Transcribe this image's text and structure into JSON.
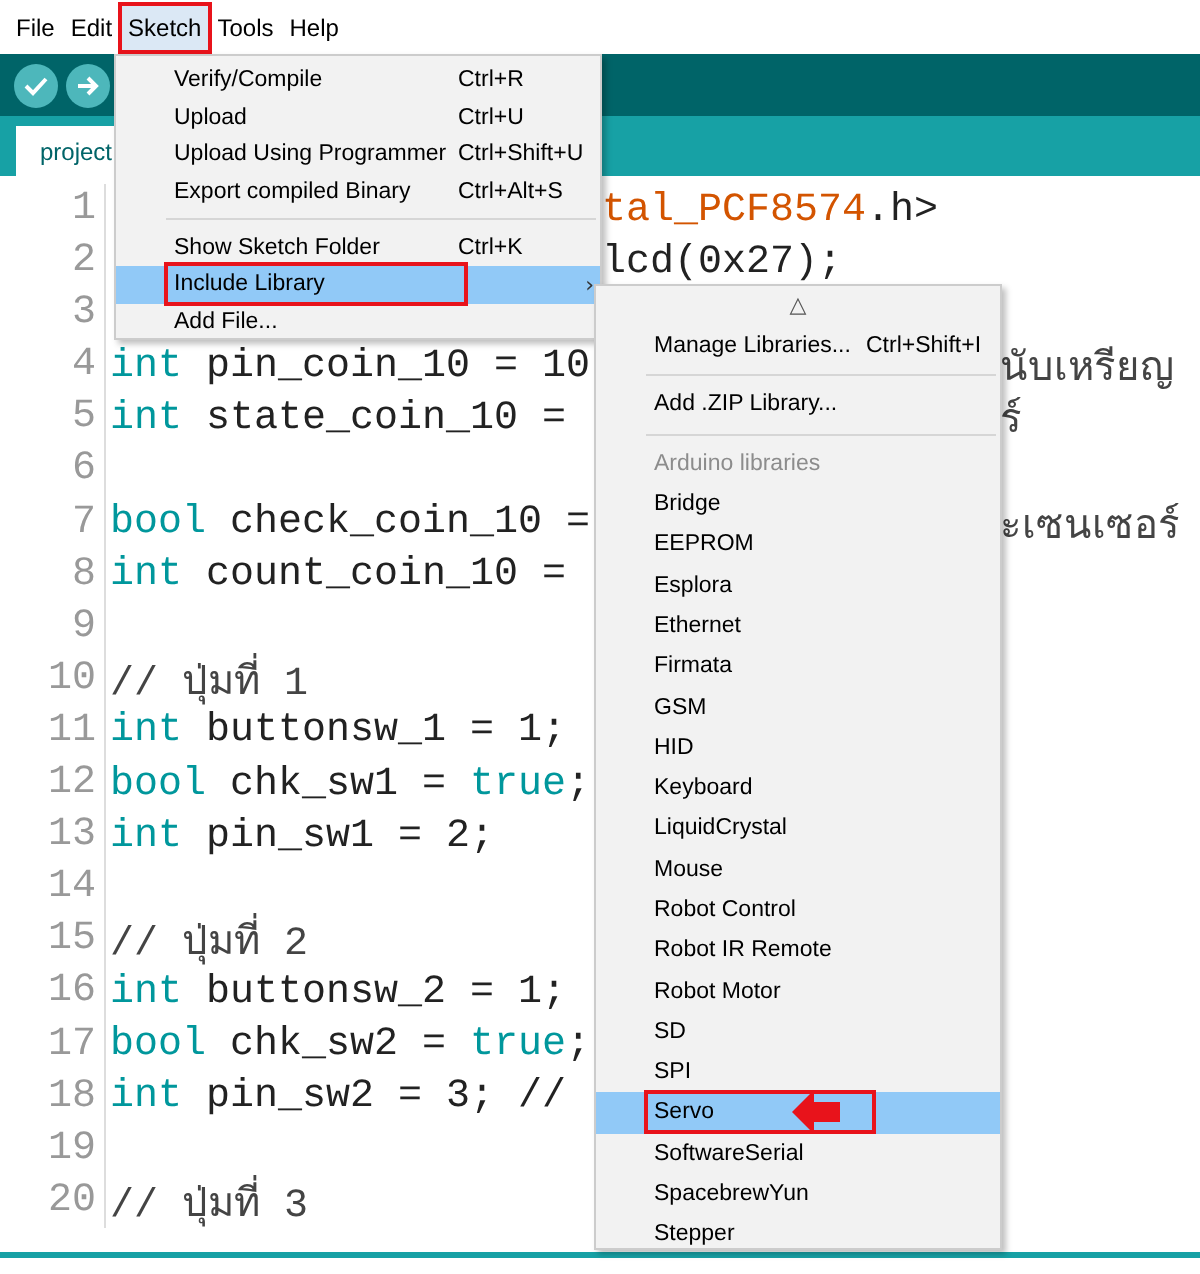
{
  "menu_bar": [
    {
      "label": "File",
      "selected": false
    },
    {
      "label": "Edit",
      "selected": false
    },
    {
      "label": "Sketch",
      "selected": true
    },
    {
      "label": "Tools",
      "selected": false
    },
    {
      "label": "Help",
      "selected": false
    }
  ],
  "tab": {
    "label": "project"
  },
  "editor_lines": [
    {
      "number": "1",
      "tail": {
        "kind": "beside-menu",
        "tokens": [
          {
            "text": "tal_PCF8574",
            "kind": "library"
          },
          {
            "text": ".h>",
            "kind": "plain"
          }
        ]
      }
    },
    {
      "number": "2",
      "tail": {
        "kind": "beside-menu",
        "tokens": [
          {
            "text": "lcd(0x27);",
            "kind": "plain"
          }
        ]
      }
    },
    {
      "number": "3"
    },
    {
      "number": "4",
      "code": [
        {
          "text": "int",
          "kind": "keyword"
        },
        {
          "text": " pin_coin_10 = 10",
          "kind": "plain"
        }
      ],
      "tail": {
        "kind": "beside-submenu",
        "tokens": [
          {
            "text": "นับเหรียญ",
            "kind": "comment"
          }
        ]
      }
    },
    {
      "number": "5",
      "code": [
        {
          "text": "int",
          "kind": "keyword"
        },
        {
          "text": " state_coin_10 =",
          "kind": "plain"
        }
      ],
      "tail": {
        "kind": "beside-submenu",
        "tokens": [
          {
            "text": "ร์",
            "kind": "comment"
          }
        ]
      }
    },
    {
      "number": "6"
    },
    {
      "number": "7",
      "code": [
        {
          "text": "bool",
          "kind": "keyword"
        },
        {
          "text": " check_coin_10 =",
          "kind": "plain"
        }
      ],
      "tail": {
        "kind": "beside-submenu",
        "tokens": [
          {
            "text": "ะเซนเซอร์",
            "kind": "comment"
          }
        ]
      }
    },
    {
      "number": "8",
      "code": [
        {
          "text": "int",
          "kind": "keyword"
        },
        {
          "text": " count_coin_10 =",
          "kind": "plain"
        }
      ]
    },
    {
      "number": "9"
    },
    {
      "number": "10",
      "code": [
        {
          "text": "// ปุ่มที่ 1",
          "kind": "comment"
        }
      ]
    },
    {
      "number": "11",
      "code": [
        {
          "text": "int",
          "kind": "keyword"
        },
        {
          "text": " buttonsw_1 = 1;",
          "kind": "plain"
        }
      ]
    },
    {
      "number": "12",
      "code": [
        {
          "text": "bool",
          "kind": "keyword"
        },
        {
          "text": " chk_sw1 = ",
          "kind": "plain"
        },
        {
          "text": "true",
          "kind": "keyword"
        },
        {
          "text": ";",
          "kind": "plain"
        }
      ]
    },
    {
      "number": "13",
      "code": [
        {
          "text": "int",
          "kind": "keyword"
        },
        {
          "text": " pin_sw1 = 2;",
          "kind": "plain"
        }
      ]
    },
    {
      "number": "14"
    },
    {
      "number": "15",
      "code": [
        {
          "text": "// ปุ่มที่ 2",
          "kind": "comment"
        }
      ]
    },
    {
      "number": "16",
      "code": [
        {
          "text": "int",
          "kind": "keyword"
        },
        {
          "text": " buttonsw_2 = 1;",
          "kind": "plain"
        }
      ]
    },
    {
      "number": "17",
      "code": [
        {
          "text": "bool",
          "kind": "keyword"
        },
        {
          "text": " chk_sw2 = ",
          "kind": "plain"
        },
        {
          "text": "true",
          "kind": "keyword"
        },
        {
          "text": ";",
          "kind": "plain"
        }
      ]
    },
    {
      "number": "18",
      "code": [
        {
          "text": "int",
          "kind": "keyword"
        },
        {
          "text": " pin_sw2 = 3; //",
          "kind": "plain"
        }
      ]
    },
    {
      "number": "19"
    },
    {
      "number": "20",
      "code": [
        {
          "text": "// ปุ่มที่ 3",
          "kind": "comment"
        }
      ]
    }
  ],
  "sketch_menu": [
    {
      "kind": "item",
      "label": "Verify/Compile",
      "shortcut": "Ctrl+R",
      "selected": false
    },
    {
      "kind": "item",
      "label": "Upload",
      "shortcut": "Ctrl+U",
      "selected": false
    },
    {
      "kind": "item",
      "label": "Upload Using Programmer",
      "shortcut": "Ctrl+Shift+U",
      "selected": false
    },
    {
      "kind": "item",
      "label": "Export compiled Binary",
      "shortcut": "Ctrl+Alt+S",
      "selected": false
    },
    {
      "kind": "separator"
    },
    {
      "kind": "item",
      "label": "Show Sketch Folder",
      "shortcut": "Ctrl+K",
      "selected": false
    },
    {
      "kind": "submenu",
      "label": "Include Library",
      "arrow": "›",
      "selected": true
    },
    {
      "kind": "item",
      "label": "Add File...",
      "selected": false
    }
  ],
  "library_menu": {
    "scroll_up": "△",
    "items": [
      {
        "kind": "item",
        "label": "Manage Libraries...",
        "shortcut": "Ctrl+Shift+I",
        "selected": false
      },
      {
        "kind": "separator"
      },
      {
        "kind": "item",
        "label": "Add .ZIP Library...",
        "selected": false
      },
      {
        "kind": "separator"
      },
      {
        "kind": "header",
        "label": "Arduino libraries"
      },
      {
        "kind": "item",
        "label": "Bridge",
        "selected": false
      },
      {
        "kind": "item",
        "label": "EEPROM",
        "selected": false
      },
      {
        "kind": "item",
        "label": "Esplora",
        "selected": false
      },
      {
        "kind": "item",
        "label": "Ethernet",
        "selected": false
      },
      {
        "kind": "item",
        "label": "Firmata",
        "selected": false
      },
      {
        "kind": "item",
        "label": "GSM",
        "selected": false
      },
      {
        "kind": "item",
        "label": "HID",
        "selected": false
      },
      {
        "kind": "item",
        "label": "Keyboard",
        "selected": false
      },
      {
        "kind": "item",
        "label": "LiquidCrystal",
        "selected": false
      },
      {
        "kind": "item",
        "label": "Mouse",
        "selected": false
      },
      {
        "kind": "item",
        "label": "Robot Control",
        "selected": false
      },
      {
        "kind": "item",
        "label": "Robot IR Remote",
        "selected": false
      },
      {
        "kind": "item",
        "label": "Robot Motor",
        "selected": false
      },
      {
        "kind": "item",
        "label": "SD",
        "selected": false
      },
      {
        "kind": "item",
        "label": "SPI",
        "selected": false
      },
      {
        "kind": "item",
        "label": "Servo",
        "selected": true
      },
      {
        "kind": "item",
        "label": "SoftwareSerial",
        "selected": false
      },
      {
        "kind": "item",
        "label": "SpacebrewYun",
        "selected": false
      },
      {
        "kind": "item",
        "label": "Stepper",
        "selected": false
      }
    ]
  }
}
